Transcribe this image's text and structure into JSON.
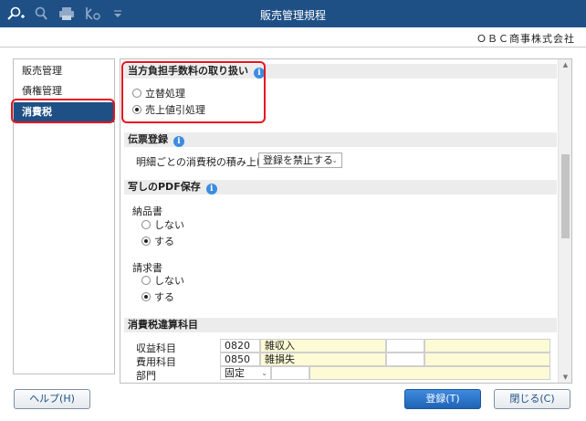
{
  "window": {
    "title": "販売管理規程"
  },
  "toolbar": {
    "icons": [
      "search-plus-icon",
      "zoom-icon",
      "print-icon",
      "pdf-output-icon",
      "menu-caret-icon"
    ]
  },
  "company": "ＯＢＣ商事株式会社",
  "nav": {
    "items": [
      {
        "label": "販売管理"
      },
      {
        "label": "債権管理"
      },
      {
        "label": "消費税"
      }
    ],
    "active_index": 2
  },
  "sections": {
    "commission": {
      "heading": "当方負担手数料の取り扱い",
      "options": [
        {
          "label": "立替処理",
          "selected": false
        },
        {
          "label": "売上値引処理",
          "selected": true
        }
      ]
    },
    "voucher": {
      "heading": "伝票登録",
      "row_label": "明細ごとの消費税の積み上げ",
      "select_value": "登録を禁止する"
    },
    "pdf": {
      "heading": "写しのPDF保存",
      "delivery": {
        "label": "納品書",
        "options": [
          {
            "label": "しない",
            "selected": false
          },
          {
            "label": "する",
            "selected": true
          }
        ]
      },
      "invoice": {
        "label": "請求書",
        "options": [
          {
            "label": "しない",
            "selected": false
          },
          {
            "label": "する",
            "selected": true
          }
        ]
      }
    },
    "tax_accounts": {
      "heading": "消費税違算科目",
      "rows": [
        {
          "label": "収益科目",
          "code": "0820",
          "name": "雑収入"
        },
        {
          "label": "費用科目",
          "code": "0850",
          "name": "雑損失"
        },
        {
          "label": "部門",
          "code": "固定",
          "name": ""
        }
      ]
    }
  },
  "buttons": {
    "help": "ヘルプ(H)",
    "register": "登録(T)",
    "close": "閉じる(C)"
  },
  "colors": {
    "titlebar": "#1e5086",
    "highlight": "#e8141e",
    "info": "#3c8de0",
    "table_fill": "#fdfbd5"
  }
}
